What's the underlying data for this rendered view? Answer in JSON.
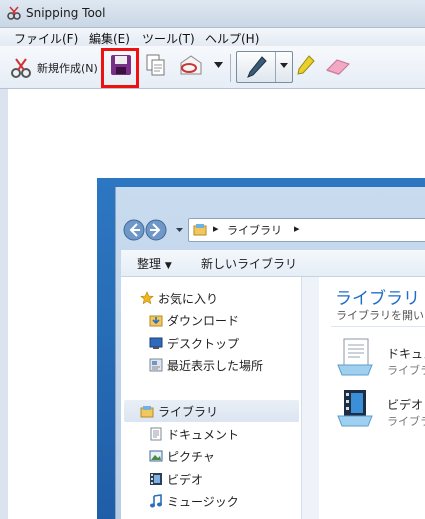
{
  "window": {
    "title": "Snipping Tool"
  },
  "menu": [
    "ファイル(F)",
    "編集(E)",
    "ツール(T)",
    "ヘルプ(H)"
  ],
  "toolbar": {
    "new_label": "新規作成(N)"
  },
  "explorer": {
    "breadcrumb": "ライブラリ",
    "toolbar": {
      "organize": "整理",
      "new_library": "新しいライブラリ"
    },
    "nav": {
      "favorites": "お気に入り",
      "downloads": "ダウンロード",
      "desktop": "デスクトップ",
      "recent": "最近表示した場所",
      "libraries": "ライブラリ",
      "documents": "ドキュメント",
      "pictures": "ピクチャ",
      "videos": "ビデオ",
      "music": "ミュージック"
    },
    "content": {
      "heading": "ライブラリ",
      "subtitle": "ライブラリを開い",
      "items": [
        {
          "name": "ドキュメ",
          "type": "ライブラ"
        },
        {
          "name": "ビデオ",
          "type": "ライブラ"
        }
      ]
    }
  },
  "colors": {
    "highlight": "#e11111",
    "heading": "#1e6ec8"
  }
}
